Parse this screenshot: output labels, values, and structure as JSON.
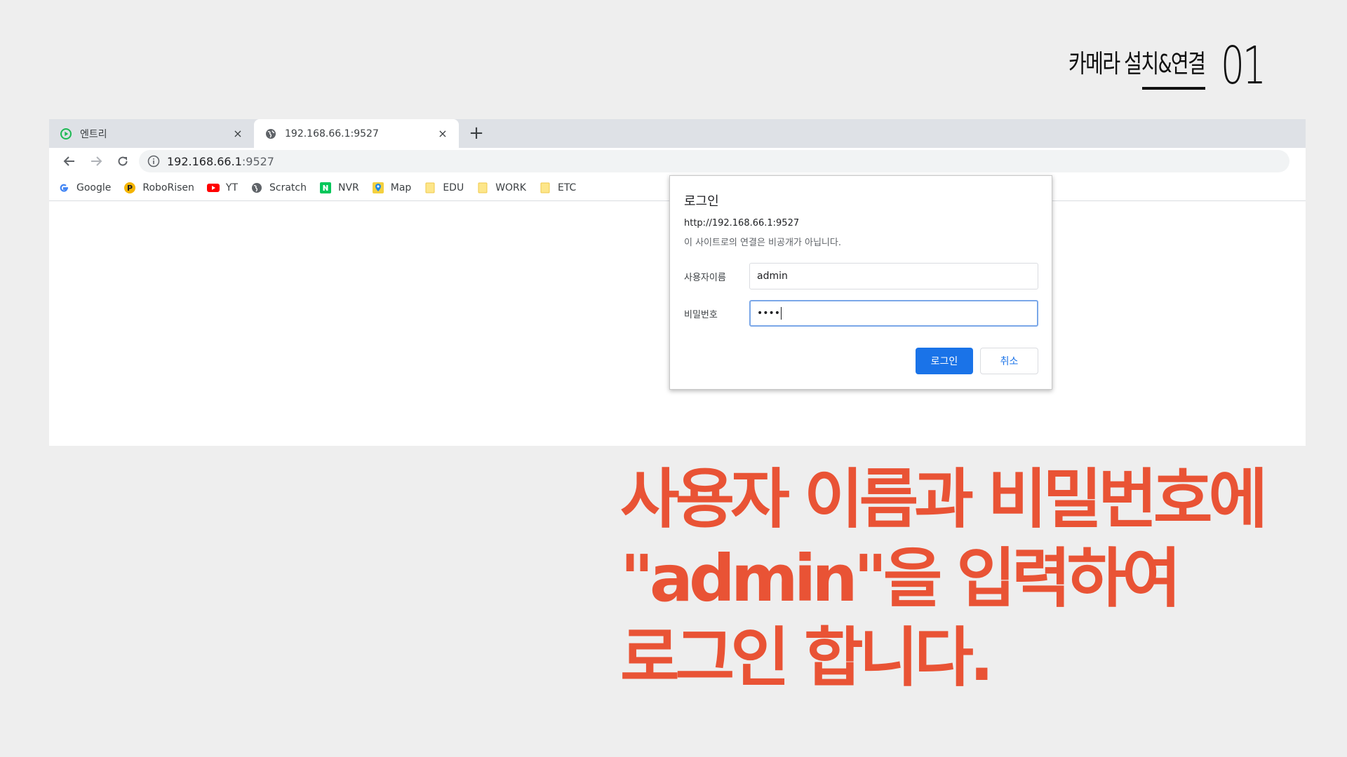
{
  "slide": {
    "title": "카메라 설치&연결",
    "number": "01"
  },
  "browser": {
    "tabs": [
      {
        "label": "엔트리",
        "icon": "entry-play-icon"
      },
      {
        "label": "192.168.66.1:9527",
        "icon": "globe-icon"
      }
    ],
    "close_glyph": "×",
    "new_tab_glyph": "+",
    "address": {
      "host": "192.168.66.1",
      "port": ":9527"
    },
    "bookmarks": [
      {
        "label": "Google",
        "icon": "google-icon"
      },
      {
        "label": "RoboRisen",
        "icon": "roborisen-icon"
      },
      {
        "label": "YT",
        "icon": "youtube-icon"
      },
      {
        "label": "Scratch",
        "icon": "globe-icon"
      },
      {
        "label": "NVR",
        "icon": "naver-icon"
      },
      {
        "label": "Map",
        "icon": "map-icon"
      },
      {
        "label": "EDU",
        "icon": "folder-icon"
      },
      {
        "label": "WORK",
        "icon": "folder-icon"
      },
      {
        "label": "ETC",
        "icon": "folder-icon"
      }
    ]
  },
  "dialog": {
    "title": "로그인",
    "origin": "http://192.168.66.1:9527",
    "warning": "이 사이트로의 연결은 비공개가 아닙니다.",
    "username_label": "사용자이름",
    "username_value": "admin",
    "password_label": "비밀번호",
    "password_value": "••••",
    "login_button": "로그인",
    "cancel_button": "취소"
  },
  "caption": {
    "line1": "사용자 이름과 비밀번호에",
    "line2": "\"admin\"을 입력하여",
    "line3": "로그인 합니다."
  },
  "colors": {
    "caption": "#e95335",
    "primary_button": "#1a73e8",
    "tabstrip": "#dee1e6"
  }
}
